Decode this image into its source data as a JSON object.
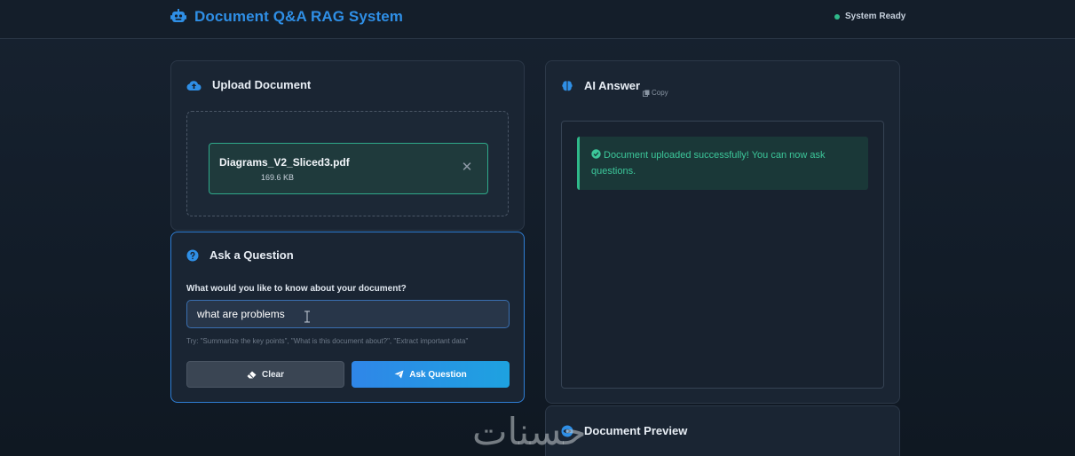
{
  "header": {
    "title": "Document Q&A RAG System",
    "logo_icon": "robot-icon",
    "status_text": "System Ready",
    "status_color": "#2fb98a",
    "accent_color": "#2f8fe6"
  },
  "upload": {
    "title": "Upload Document",
    "icon": "cloud-upload-icon",
    "file": {
      "name": "Diagrams_V2_Sliced3.pdf",
      "size": "169.6 KB"
    },
    "remove_icon": "close-icon",
    "remove_glyph": "✕"
  },
  "question": {
    "title": "Ask a Question",
    "icon": "question-circle-icon",
    "label": "What would you like to know about your document?",
    "input_value": "what are problems",
    "hint": "Try: \"Summarize the key points\", \"What is this document about?\", \"Extract important data\"",
    "clear_label": "Clear",
    "clear_icon": "eraser-icon",
    "ask_label": "Ask Question",
    "ask_icon": "paper-plane-icon"
  },
  "answer": {
    "title": "AI Answer",
    "icon": "brain-icon",
    "copy_label": "Copy",
    "copy_icon": "copy-icon",
    "message": "Document uploaded successfully! You can now ask questions.",
    "message_icon": "check-circle-icon",
    "message_color": "#3cc79a"
  },
  "preview": {
    "title": "Document Preview",
    "icon": "eye-icon"
  },
  "watermark": {
    "text": "حسنات"
  }
}
